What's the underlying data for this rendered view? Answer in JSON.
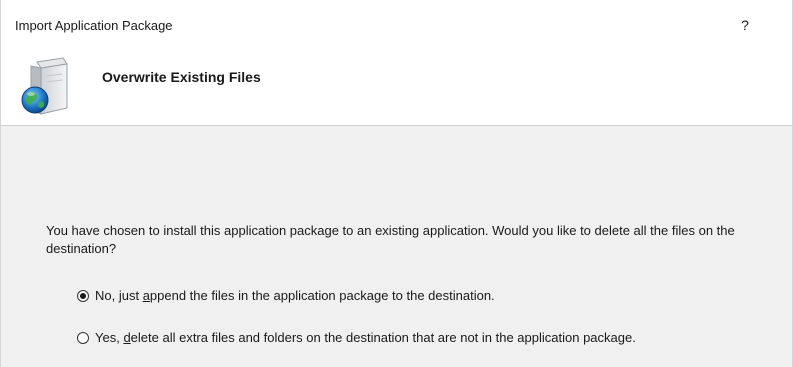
{
  "window": {
    "title": "Import Application Package",
    "help_label": "?"
  },
  "header": {
    "title": "Overwrite Existing Files",
    "icon": "package-globe-icon"
  },
  "content": {
    "description": "You have chosen to install this application package to an existing application. Would you like to delete all the files on the destination?",
    "options": [
      {
        "prefix": "No, just ",
        "accel": "a",
        "suffix": "ppend the files in the application package to the destination.",
        "selected": true
      },
      {
        "prefix": "Yes, ",
        "accel": "d",
        "suffix": "elete all extra files and folders on the destination that are not in the application package.",
        "selected": false
      }
    ]
  },
  "colors": {
    "background": "#f0f0f0",
    "header_background": "#ffffff",
    "text": "#1a1a1a"
  }
}
